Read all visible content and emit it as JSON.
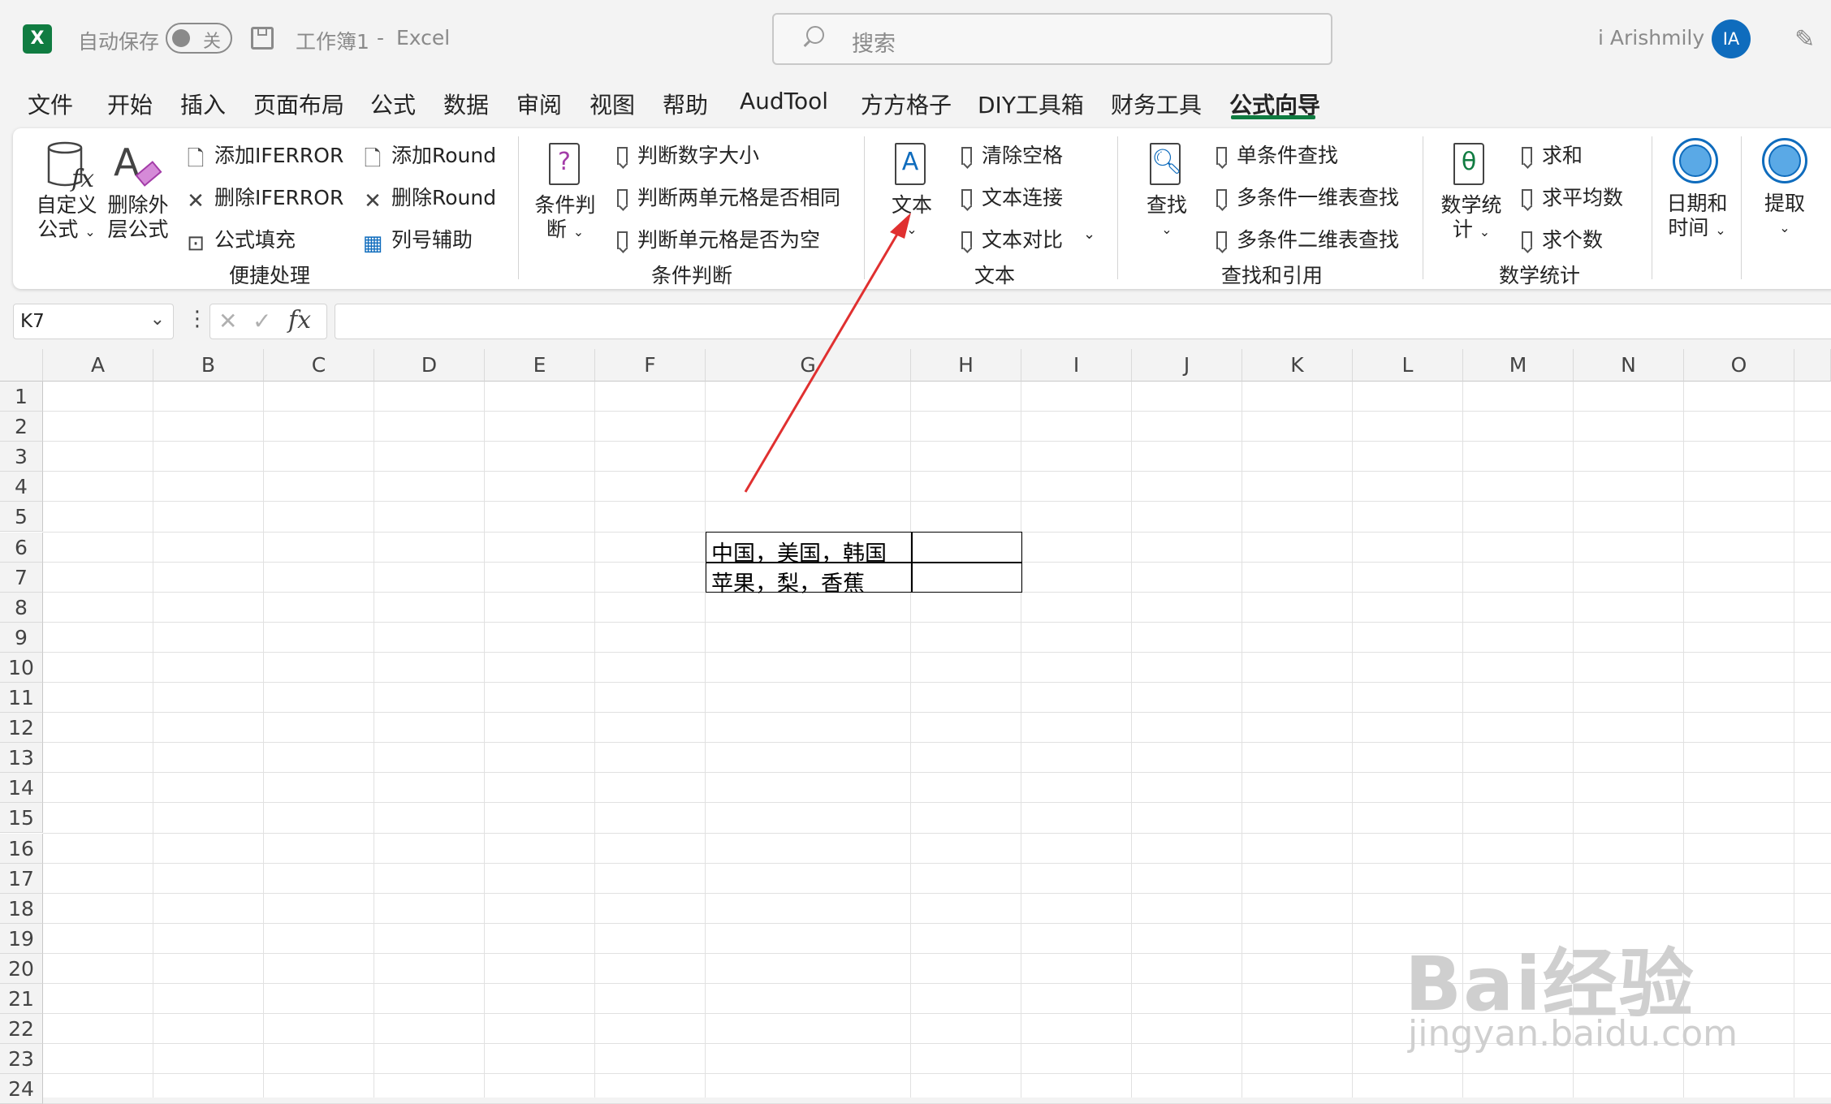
{
  "titlebar": {
    "autosave_label": "自动保存",
    "toggle_state": "关",
    "doc_title": "工作簿1",
    "title_sep": "-",
    "app_name": "Excel",
    "search_placeholder": "搜索",
    "user_name": "i Arishmily",
    "avatar_initials": "IA"
  },
  "tabs": [
    {
      "label": "文件"
    },
    {
      "label": "开始"
    },
    {
      "label": "插入"
    },
    {
      "label": "页面布局"
    },
    {
      "label": "公式"
    },
    {
      "label": "数据"
    },
    {
      "label": "审阅"
    },
    {
      "label": "视图"
    },
    {
      "label": "帮助"
    },
    {
      "label": "AudTool"
    },
    {
      "label": "方方格子"
    },
    {
      "label": "DIY工具箱"
    },
    {
      "label": "财务工具"
    },
    {
      "label": "公式向导"
    }
  ],
  "ribbon": {
    "group1": {
      "label": "便捷处理",
      "custom_formula": [
        "自定义",
        "公式"
      ],
      "delete_outer": [
        "删除外",
        "层公式"
      ],
      "add_iferror": "添加IFERROR",
      "del_iferror": "删除IFERROR",
      "formula_fill": "公式填充",
      "add_round": "添加Round",
      "del_round": "删除Round",
      "col_assist": "列号辅助"
    },
    "group2": {
      "label": "条件判断",
      "cond": [
        "条件判",
        "断"
      ],
      "item1": "判断数字大小",
      "item2": "判断两单元格是否相同",
      "item3": "判断单元格是否为空"
    },
    "group3": {
      "label": "文本",
      "text_btn": "文本",
      "item1": "清除空格",
      "item2": "文本连接",
      "item3": "文本对比"
    },
    "group4": {
      "label": "查找和引用",
      "find_btn": "查找",
      "item1": "单条件查找",
      "item2": "多条件一维表查找",
      "item3": "多条件二维表查找"
    },
    "group5": {
      "label": "数学统计",
      "math_btn": [
        "数学统",
        "计"
      ],
      "item1": "求和",
      "item2": "求平均数",
      "item3": "求个数"
    },
    "datetime": [
      "日期和",
      "时间"
    ],
    "extract": "提取"
  },
  "formula_bar": {
    "name_box": "K7",
    "fx": "fx",
    "formula": ""
  },
  "sheet": {
    "columns": [
      "A",
      "B",
      "C",
      "D",
      "E",
      "F",
      "G",
      "H",
      "I",
      "J",
      "K",
      "L",
      "M",
      "N",
      "O"
    ],
    "rows": [
      "1",
      "2",
      "3",
      "4",
      "5",
      "6",
      "7",
      "8",
      "9",
      "10",
      "11",
      "12",
      "13",
      "14",
      "15",
      "16",
      "17",
      "18",
      "19",
      "20",
      "21",
      "22",
      "23",
      "24"
    ],
    "cells": {
      "G6": "中国，美国，韩国",
      "G7": "苹果，梨，香蕉"
    }
  },
  "watermark": {
    "logo_text": "Bai经验",
    "url": "jingyan.baidu.com"
  },
  "colors": {
    "excel_green": "#107c41",
    "arrow_red": "#e03030",
    "avatar_blue": "#0f6cbd"
  }
}
